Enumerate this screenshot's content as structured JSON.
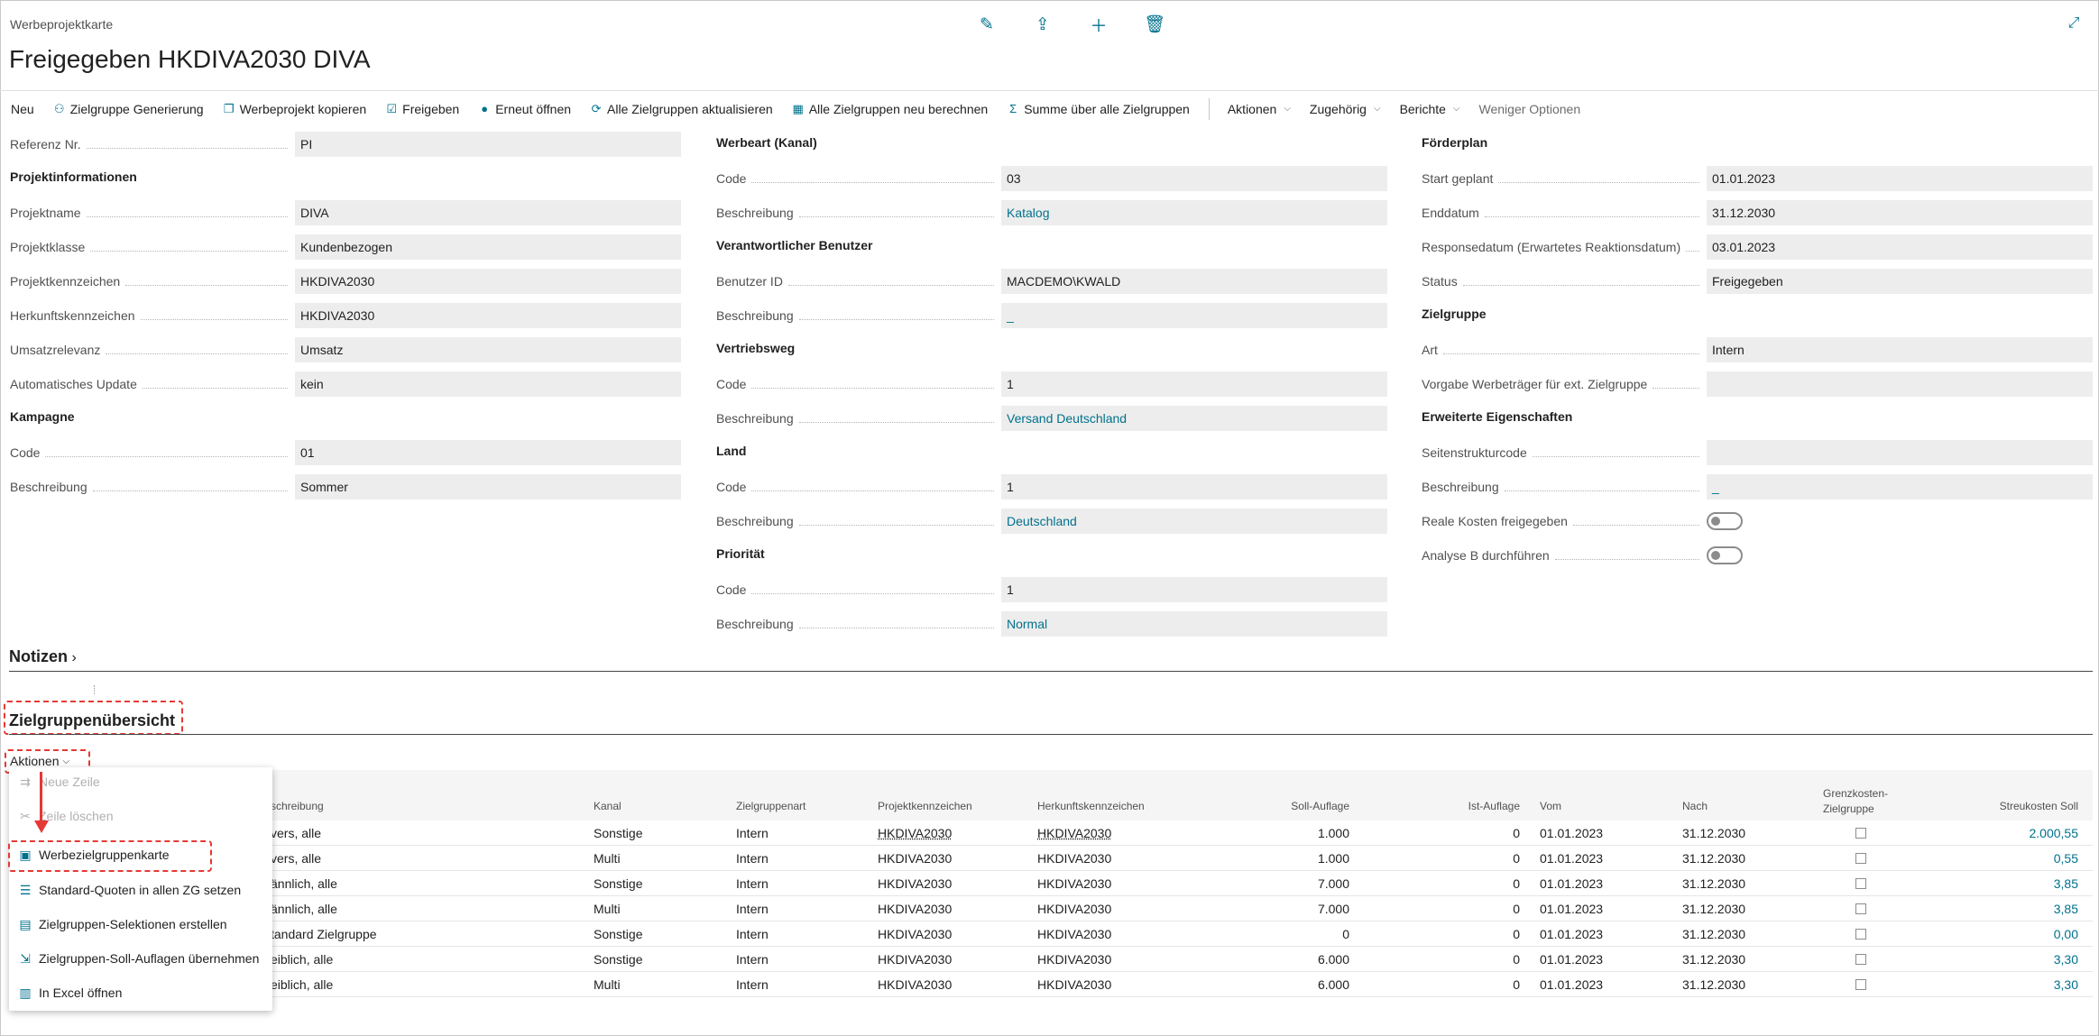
{
  "page": {
    "caption": "Werbeprojektkarte",
    "title": "Freigegeben HKDIVA2030 DIVA"
  },
  "toolbar": {
    "items": [
      {
        "label": "Neu",
        "icon": ""
      },
      {
        "label": "Zielgruppe Generierung",
        "icon": "people-icon"
      },
      {
        "label": "Werbeprojekt kopieren",
        "icon": "copy-icon"
      },
      {
        "label": "Freigeben",
        "icon": "document-check-icon"
      },
      {
        "label": "Erneut öffnen",
        "icon": "reopen-icon"
      },
      {
        "label": "Alle Zielgruppen aktualisieren",
        "icon": "refresh-icon"
      },
      {
        "label": "Alle Zielgruppen neu berechnen",
        "icon": "calculator-icon"
      },
      {
        "label": "Summe über alle Zielgruppen",
        "icon": "sum-icon"
      }
    ],
    "menus": [
      "Aktionen",
      "Zugehörig",
      "Berichte"
    ],
    "less_options": "Weniger Optionen"
  },
  "fields": {
    "referenz_label": "Referenz Nr.",
    "referenz_value": "PI",
    "projektinfo_header": "Projektinformationen",
    "projektname_label": "Projektname",
    "projektname_value": "DIVA",
    "projektklasse_label": "Projektklasse",
    "projektklasse_value": "Kundenbezogen",
    "projektkz_label": "Projektkennzeichen",
    "projektkz_value": "HKDIVA2030",
    "herkunftkz_label": "Herkunftskennzeichen",
    "herkunftkz_value": "HKDIVA2030",
    "umsatz_label": "Umsatzrelevanz",
    "umsatz_value": "Umsatz",
    "autoupdate_label": "Automatisches Update",
    "autoupdate_value": "kein",
    "kampagne_header": "Kampagne",
    "kampagne_code_label": "Code",
    "kampagne_code_value": "01",
    "kampagne_beschr_label": "Beschreibung",
    "kampagne_beschr_value": "Sommer",
    "werbeart_header": "Werbeart (Kanal)",
    "werbeart_code_label": "Code",
    "werbeart_code_value": "03",
    "werbeart_beschr_label": "Beschreibung",
    "werbeart_beschr_value": "Katalog",
    "benutzer_header": "Verantwortlicher Benutzer",
    "benutzer_id_label": "Benutzer ID",
    "benutzer_id_value": "MACDEMO\\KWALD",
    "benutzer_beschr_label": "Beschreibung",
    "benutzer_beschr_value": "_",
    "vertrieb_header": "Vertriebsweg",
    "vertrieb_code_label": "Code",
    "vertrieb_code_value": "1",
    "vertrieb_beschr_label": "Beschreibung",
    "vertrieb_beschr_value": "Versand Deutschland",
    "land_header": "Land",
    "land_code_label": "Code",
    "land_code_value": "1",
    "land_beschr_label": "Beschreibung",
    "land_beschr_value": "Deutschland",
    "prio_header": "Priorität",
    "prio_code_label": "Code",
    "prio_code_value": "1",
    "prio_beschr_label": "Beschreibung",
    "prio_beschr_value": "Normal",
    "foerder_header": "Förderplan",
    "start_label": "Start geplant",
    "start_value": "01.01.2023",
    "end_label": "Enddatum",
    "end_value": "31.12.2030",
    "response_label": "Responsedatum (Erwartetes Reaktionsdatum)",
    "response_value": "03.01.2023",
    "status_label": "Status",
    "status_value": "Freigegeben",
    "zielgruppe_header": "Zielgruppe",
    "art_label": "Art",
    "art_value": "Intern",
    "vorgabe_label": "Vorgabe Werbeträger für ext. Zielgruppe",
    "vorgabe_value": "",
    "erw_header": "Erweiterte Eigenschaften",
    "seiten_label": "Seitenstrukturcode",
    "seiten_value": "",
    "erw_beschr_label": "Beschreibung",
    "erw_beschr_value": "_",
    "reale_label": "Reale Kosten freigegeben",
    "analyse_label": "Analyse B durchführen"
  },
  "toggles": {
    "reale": false,
    "analyse": false
  },
  "notes": {
    "title": "Notizen"
  },
  "zg": {
    "title": "Zielgruppenübersicht",
    "aktionen": "Aktionen",
    "columns": [
      "schreibung",
      "Kanal",
      "Zielgruppenart",
      "Projektkennzeichen",
      "Herkunftskennzeichen",
      "Soll-Auflage",
      "Ist-Auflage",
      "Vom",
      "Nach",
      "Grenzkosten-",
      "Zielgruppe",
      "Streukosten Soll"
    ],
    "rows": [
      [
        "vers, alle",
        "Sonstige",
        "Intern",
        "HKDIVA2030",
        "HKDIVA2030",
        "1.000",
        "0",
        "01.01.2023",
        "31.12.2030",
        "2.000,55"
      ],
      [
        "vers, alle",
        "Multi",
        "Intern",
        "HKDIVA2030",
        "HKDIVA2030",
        "1.000",
        "0",
        "01.01.2023",
        "31.12.2030",
        "0,55"
      ],
      [
        "ännlich, alle",
        "Sonstige",
        "Intern",
        "HKDIVA2030",
        "HKDIVA2030",
        "7.000",
        "0",
        "01.01.2023",
        "31.12.2030",
        "3,85"
      ],
      [
        "ännlich, alle",
        "Multi",
        "Intern",
        "HKDIVA2030",
        "HKDIVA2030",
        "7.000",
        "0",
        "01.01.2023",
        "31.12.2030",
        "3,85"
      ],
      [
        "tandard Zielgruppe",
        "Sonstige",
        "Intern",
        "HKDIVA2030",
        "HKDIVA2030",
        "0",
        "0",
        "01.01.2023",
        "31.12.2030",
        "0,00"
      ],
      [
        "eiblich, alle",
        "Sonstige",
        "Intern",
        "HKDIVA2030",
        "HKDIVA2030",
        "6.000",
        "0",
        "01.01.2023",
        "31.12.2030",
        "3,30"
      ],
      [
        "eiblich, alle",
        "Multi",
        "Intern",
        "HKDIVA2030",
        "HKDIVA2030",
        "6.000",
        "0",
        "01.01.2023",
        "31.12.2030",
        "3,30"
      ]
    ]
  },
  "menu": {
    "items": [
      {
        "label": "Neue Zeile",
        "disabled": true
      },
      {
        "label": "Zeile löschen",
        "disabled": true
      },
      {
        "label": "Werbezielgruppenkarte",
        "disabled": false
      },
      {
        "label": "Standard-Quoten in allen ZG setzen",
        "disabled": false
      },
      {
        "label": "Zielgruppen-Selektionen erstellen",
        "disabled": false
      },
      {
        "label": "Zielgruppen-Soll-Auflagen übernehmen",
        "disabled": false
      },
      {
        "label": "In Excel öffnen",
        "disabled": false
      }
    ]
  },
  "colors": {
    "accent": "#00718d",
    "highlight": "#e53935",
    "field_bg": "#ededed"
  }
}
